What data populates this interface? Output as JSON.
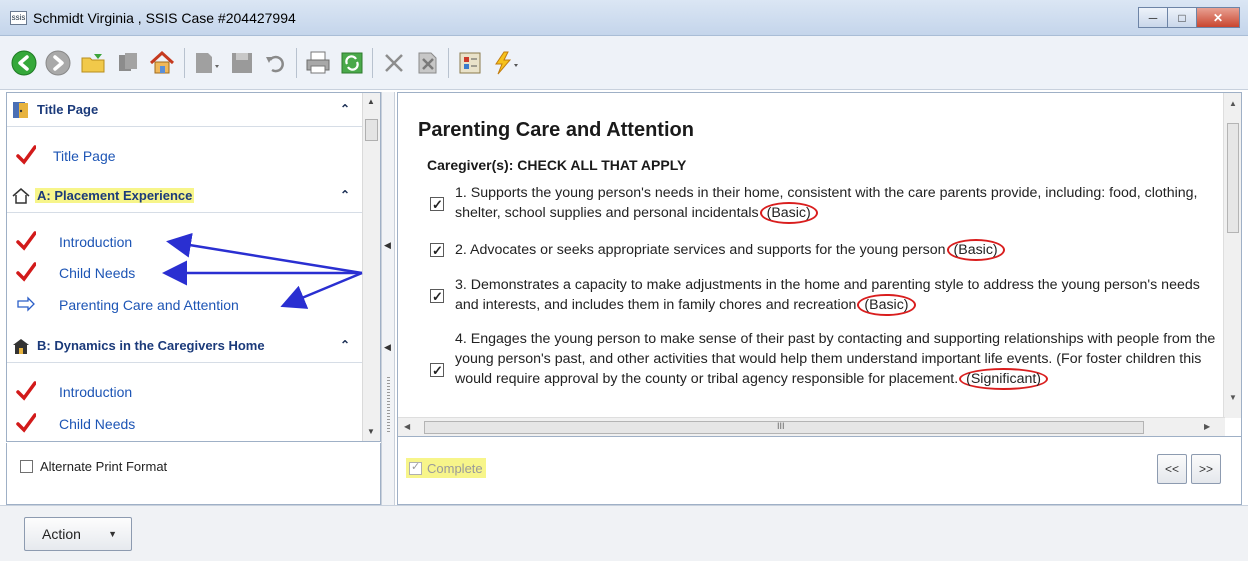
{
  "window": {
    "icon_text": "ssis",
    "title": "Schmidt Virginia , SSIS Case #204427994"
  },
  "toolbar": {
    "icons": [
      "back-icon",
      "forward-icon",
      "folder-open-icon",
      "bookmark-icon",
      "home-icon",
      "document-icon",
      "save-icon",
      "undo-icon",
      "print-icon",
      "refresh-icon",
      "delete-icon",
      "cancel-icon",
      "form-icon",
      "lightning-icon"
    ]
  },
  "sidebar": {
    "sections": [
      {
        "label": "Title Page",
        "items": [
          {
            "label": "Title Page",
            "status": "check"
          }
        ]
      },
      {
        "label": "A: Placement Experience",
        "highlighted": true,
        "items": [
          {
            "label": "Introduction",
            "status": "check"
          },
          {
            "label": "Child Needs",
            "status": "check"
          },
          {
            "label": "Parenting Care and Attention",
            "status": "current"
          }
        ]
      },
      {
        "label": "B: Dynamics in the Caregivers Home",
        "items": [
          {
            "label": "Introduction",
            "status": "check"
          },
          {
            "label": "Child Needs",
            "status": "check"
          }
        ]
      }
    ],
    "print_format_label": "Alternate Print Format"
  },
  "content": {
    "title": "Parenting Care and Attention",
    "subtitle": "Caregiver(s): CHECK ALL THAT APPLY",
    "items": [
      {
        "text": "1.  Supports the young person's needs in their home, consistent with the care parents provide, including: food, clothing, shelter, school supplies and personal incidentals",
        "tag": "(Basic)",
        "checked": true
      },
      {
        "text": "2. Advocates or seeks appropriate services and supports for the young person",
        "tag": "(Basic)",
        "checked": true
      },
      {
        "text": "3.  Demonstrates a capacity to make adjustments in the home and parenting style to address the young person's needs and interests, and includes them in family chores and recreation",
        "tag": "(Basic)",
        "checked": true
      },
      {
        "text": "4.  Engages the young person to make sense of their past by contacting and supporting relationships with people from the young person's past, and other activities that would help them understand important life events.  (For foster children this would require approval by the county or tribal agency responsible for placement.",
        "tag": "(Significant)",
        "checked": true
      }
    ],
    "scroll_grip": "III"
  },
  "footer": {
    "complete_label": "Complete",
    "complete_checked": true,
    "prev_label": "<<",
    "next_label": ">>"
  },
  "bottom": {
    "action_label": "Action"
  },
  "colors": {
    "link": "#1d55b5",
    "highlight": "#f7f58a",
    "annotation": "#d91e1e",
    "arrow": "#2a2fd1"
  }
}
